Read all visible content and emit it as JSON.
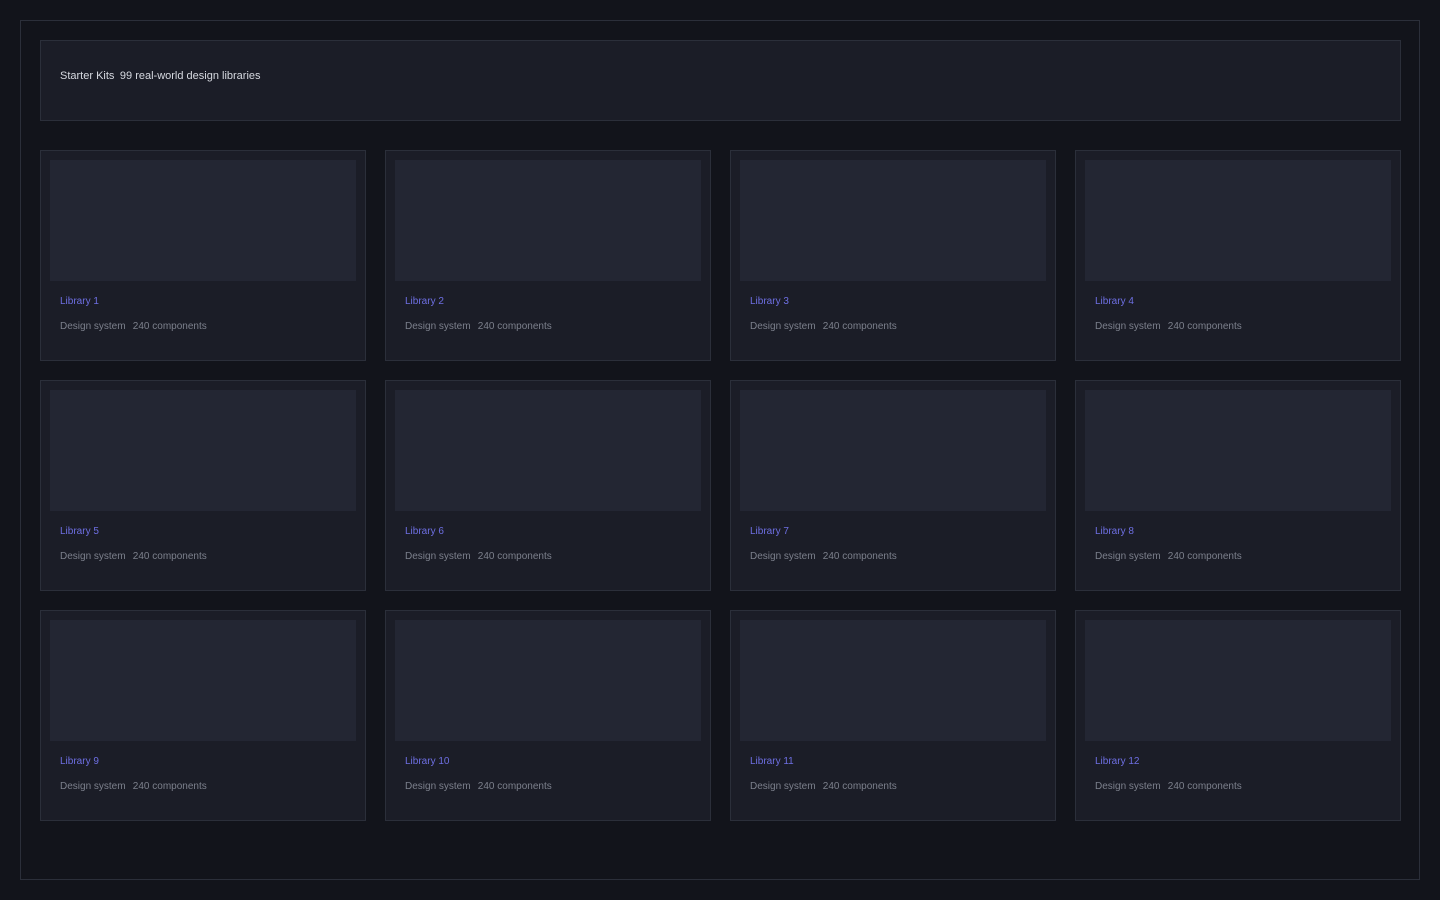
{
  "header": {
    "title": "Starter Kits 99 real-world design libraries"
  },
  "cards": [
    {
      "title": "Library 1",
      "subtitle": "Design system   240 components"
    },
    {
      "title": "Library 2",
      "subtitle": "Design system   240 components"
    },
    {
      "title": "Library 3",
      "subtitle": "Design system   240 components"
    },
    {
      "title": "Library 4",
      "subtitle": "Design system   240 components"
    },
    {
      "title": "Library 5",
      "subtitle": "Design system   240 components"
    },
    {
      "title": "Library 6",
      "subtitle": "Design system   240 components"
    },
    {
      "title": "Library 7",
      "subtitle": "Design system   240 components"
    },
    {
      "title": "Library 8",
      "subtitle": "Design system   240 components"
    },
    {
      "title": "Library 9",
      "subtitle": "Design system   240 components"
    },
    {
      "title": "Library 10",
      "subtitle": "Design system   240 components"
    },
    {
      "title": "Library 11",
      "subtitle": "Design system   240 components"
    },
    {
      "title": "Library 12",
      "subtitle": "Design system   240 components"
    }
  ],
  "colors": {
    "background": "#12141b",
    "panel": "#1b1d27",
    "border": "#2b2f3a",
    "thumbnail": "#232633",
    "accent": "#6e6fe3",
    "muted_text": "#7c808c",
    "header_text": "#d6d9e0"
  }
}
